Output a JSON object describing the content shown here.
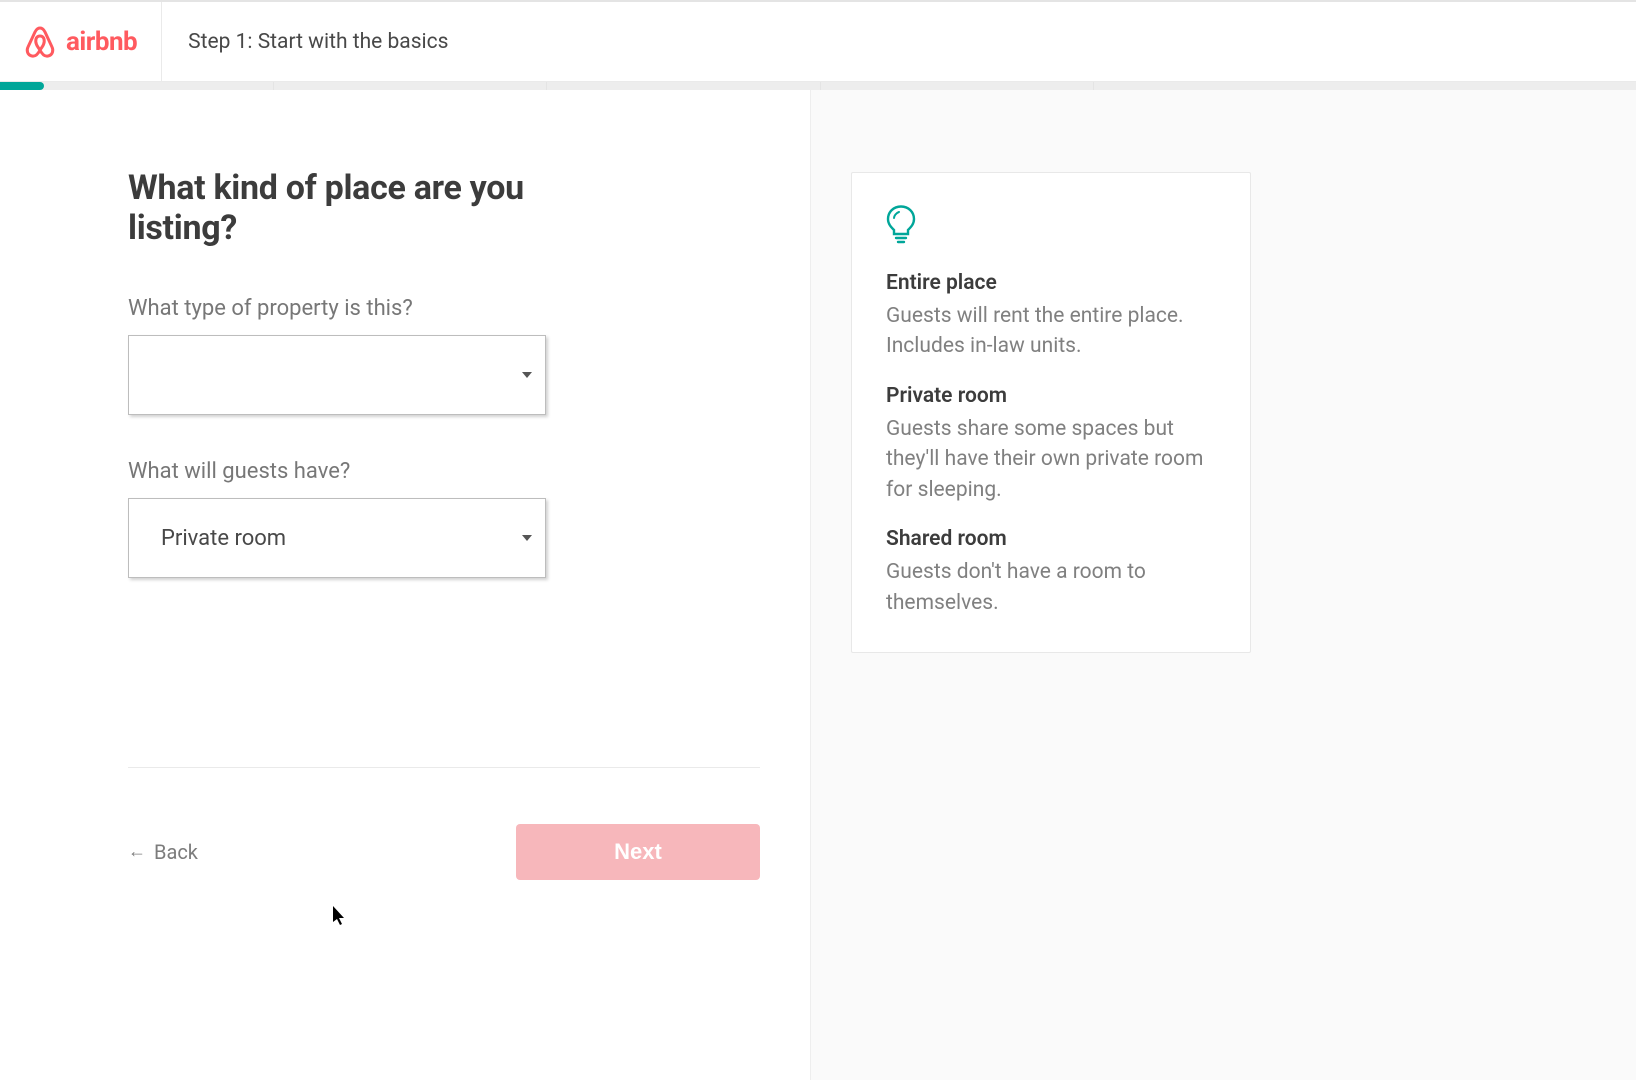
{
  "header": {
    "brand": "airbnb",
    "step_label": "Step 1: Start with the basics"
  },
  "progress": {
    "fill_percent": 2.7,
    "segments_percent": [
      16.7,
      33.4,
      50.1,
      66.8
    ]
  },
  "form": {
    "heading": "What kind of place are you listing?",
    "property_type_label": "What type of property is this?",
    "property_type_value": "",
    "room_type_label": "What will guests have?",
    "room_type_value": "Private room"
  },
  "nav": {
    "back_label": "Back",
    "next_label": "Next",
    "next_enabled": false
  },
  "tips": {
    "items": [
      {
        "title": "Entire place",
        "desc": "Guests will rent the entire place. Includes in-law units."
      },
      {
        "title": "Private room",
        "desc": "Guests share some spaces but they'll have their own private room for sleeping."
      },
      {
        "title": "Shared room",
        "desc": "Guests don't have a room to themselves."
      }
    ]
  },
  "colors": {
    "brand": "#ff5a5f",
    "teal": "#00a699"
  }
}
